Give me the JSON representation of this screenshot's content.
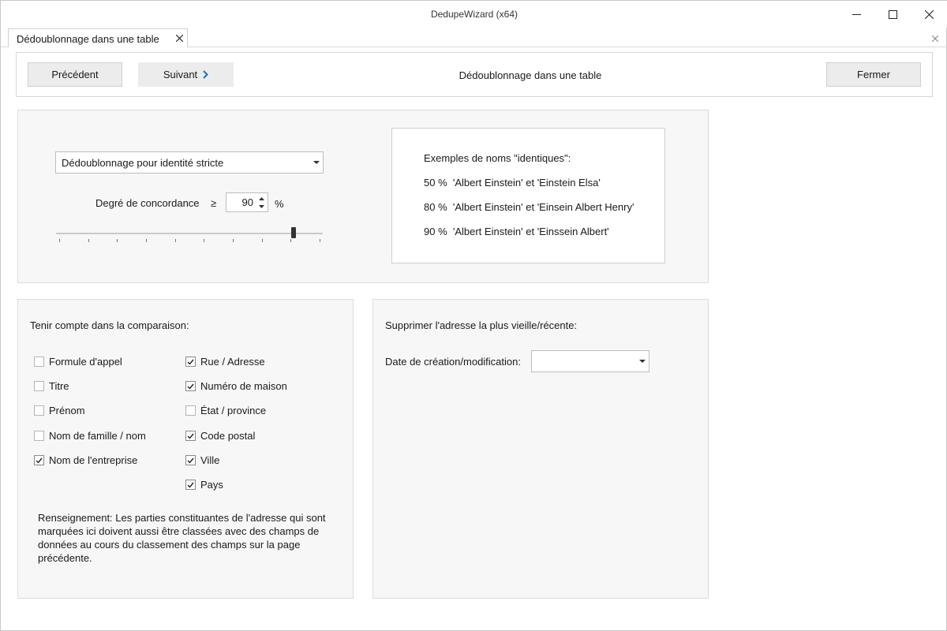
{
  "window": {
    "title": "DedupeWizard  (x64)",
    "controls": [
      "minimize-icon",
      "maximize-icon",
      "close-icon"
    ]
  },
  "tab": {
    "label": "Dédoublonnage dans une table"
  },
  "toolbar": {
    "prev_label": "Précédent",
    "next_label": "Suivant",
    "title": "Dédoublonnage dans une table",
    "close_label": "Fermer",
    "accent_color": "#1a6fc9"
  },
  "matching": {
    "mode_selected": "Dédoublonnage pour identité stricte",
    "degree_label": "Degré de concordance",
    "operator": "≥",
    "degree_value": "90",
    "unit": "%",
    "slider": {
      "value": 90,
      "min": 0,
      "max": 100,
      "tick_count": 10
    }
  },
  "examples": {
    "heading": "Exemples de noms \"identiques\":",
    "lines": [
      "50 %  'Albert Einstein' et 'Einstein Elsa'",
      "80 %  'Albert Einstein' et 'Einsein Albert Henry'",
      "90 %  'Albert Einstein' et 'Einssein Albert'"
    ]
  },
  "compare": {
    "heading": "Tenir compte dans la comparaison:",
    "left_items": [
      {
        "label": "Formule d'appel",
        "checked": false
      },
      {
        "label": "Titre",
        "checked": false
      },
      {
        "label": "Prénom",
        "checked": false
      },
      {
        "label": "Nom de famille / nom",
        "checked": false
      },
      {
        "label": "Nom de l'entreprise",
        "checked": true
      }
    ],
    "right_items": [
      {
        "label": "Rue / Adresse",
        "checked": true
      },
      {
        "label": "Numéro de maison",
        "checked": true
      },
      {
        "label": "État / province",
        "checked": false
      },
      {
        "label": "Code postal",
        "checked": true
      },
      {
        "label": "Ville",
        "checked": true
      },
      {
        "label": "Pays",
        "checked": true
      }
    ],
    "note": "Renseignement: Les parties constituantes de l'adresse qui sont marquées ici doivent aussi être classées avec des champs de données au cours du classement des champs sur la page précédente."
  },
  "delete": {
    "heading": "Supprimer l'adresse la plus vieille/récente:",
    "date_label": "Date de création/modification:",
    "date_selected": ""
  }
}
